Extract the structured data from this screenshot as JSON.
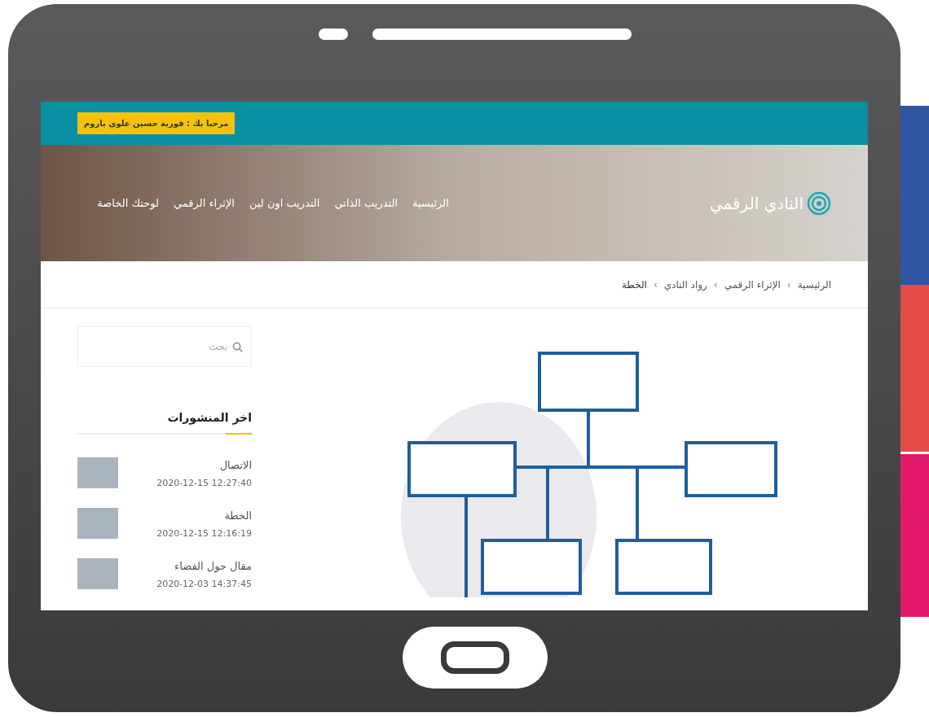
{
  "welcome_badge": "مرحبا بك : فوزية حسين علوي باروم",
  "logo": {
    "text": "النادي الرقمي"
  },
  "nav": [
    {
      "label": "الرئيسية"
    },
    {
      "label": "التدريب الذاتي"
    },
    {
      "label": "التدريب اون لين"
    },
    {
      "label": "الإثراء الرقمي"
    },
    {
      "label": "لوحتك الخاصة"
    }
  ],
  "breadcrumb": [
    {
      "kind": "link",
      "text": "الرئيسية"
    },
    {
      "kind": "separator",
      "text": "›"
    },
    {
      "kind": "link",
      "text": "الإثراء الرقمي"
    },
    {
      "kind": "separator",
      "text": "›"
    },
    {
      "kind": "link",
      "text": "رواد النادي"
    },
    {
      "kind": "separator",
      "text": "›"
    },
    {
      "kind": "current",
      "text": "الخطة"
    }
  ],
  "search": {
    "placeholder": "بحث"
  },
  "sidebar": {
    "title": "اخر المنشورات",
    "posts": [
      {
        "title": "الاتصال",
        "date": "12:27:40 2020-12-15"
      },
      {
        "title": "الخطة",
        "date": "12:16:19 2020-12-15"
      },
      {
        "title": "مقال حول الفضاء",
        "date": "14:37:45 2020-12-03"
      }
    ]
  }
}
